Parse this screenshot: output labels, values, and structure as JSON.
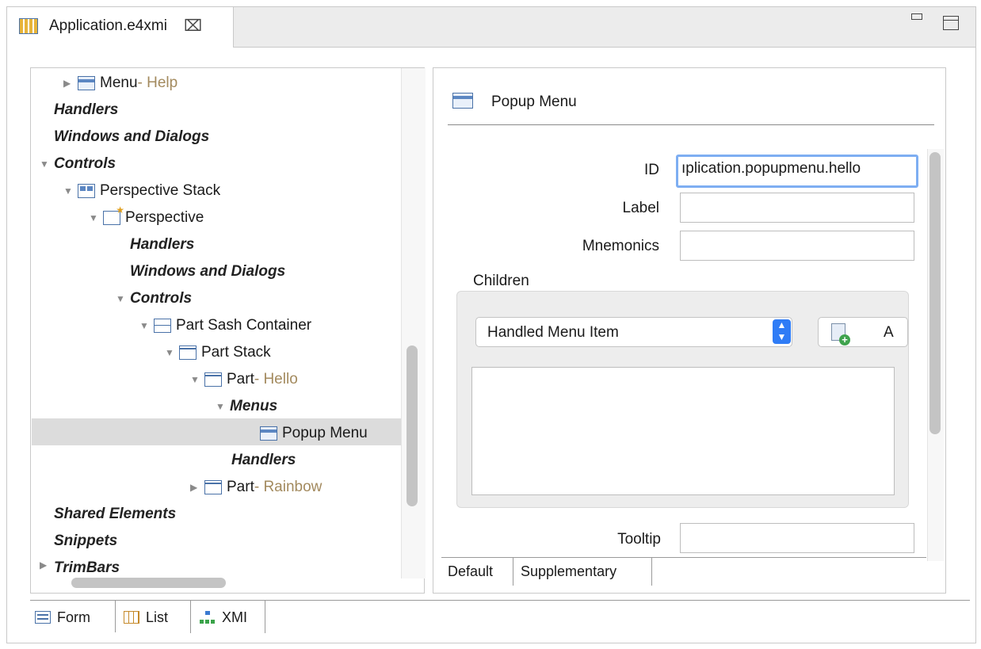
{
  "editor_tab": {
    "title": "Application.e4xmi",
    "close_glyph": "⌧",
    "icon": "model-editor-icon"
  },
  "window_controls": {
    "minimize": "minimize-icon",
    "maximize": "maximize-icon"
  },
  "tree": {
    "nodes": [
      {
        "label": "Menu",
        "suffix": " - Help",
        "twisty": "▶",
        "icon": "menu-icon"
      },
      {
        "label": "Handlers",
        "italic": true
      },
      {
        "label": "Windows and Dialogs",
        "italic": true
      },
      {
        "label": "Controls",
        "italic": true,
        "twisty": "▼"
      },
      {
        "label": "Perspective Stack",
        "twisty": "▼",
        "icon": "perspective-stack-icon"
      },
      {
        "label": "Perspective",
        "twisty": "▼",
        "icon": "perspective-icon"
      },
      {
        "label": "Handlers",
        "italic": true
      },
      {
        "label": "Windows and Dialogs",
        "italic": true
      },
      {
        "label": "Controls",
        "italic": true,
        "twisty": "▼"
      },
      {
        "label": "Part Sash Container",
        "twisty": "▼",
        "icon": "part-sash-container-icon"
      },
      {
        "label": "Part Stack",
        "twisty": "▼",
        "icon": "part-stack-icon"
      },
      {
        "label": "Part",
        "suffix": " - Hello",
        "twisty": "▼",
        "icon": "part-icon"
      },
      {
        "label": "Menus",
        "italic": true,
        "twisty": "▼"
      },
      {
        "label": "Popup Menu",
        "icon": "menu-icon",
        "selected": true
      },
      {
        "label": "Handlers",
        "italic": true
      },
      {
        "label": "Part",
        "suffix": " - Rainbow",
        "twisty": "▶",
        "icon": "part-icon"
      },
      {
        "label": "Shared Elements",
        "italic": true
      },
      {
        "label": "Snippets",
        "italic": true
      },
      {
        "label": "TrimBars",
        "italic": true,
        "twisty": "▶"
      }
    ]
  },
  "details": {
    "title": "Popup Menu",
    "id_label": "ID",
    "id_value": "ıplication.popupmenu.hello",
    "label_label": "Label",
    "label_value": "",
    "mnemonics_label": "Mnemonics",
    "mnemonics_value": "",
    "children_label": "Children",
    "children_combo_value": "Handled Menu Item",
    "add_button_label": "A",
    "tooltip_label": "Tooltip",
    "tooltip_value": "",
    "tabs": [
      "Default",
      "Supplementary"
    ]
  },
  "bottom_tabs": [
    {
      "label": "Form",
      "icon": "form-icon"
    },
    {
      "label": "List",
      "icon": "list-icon"
    },
    {
      "label": "XMI",
      "icon": "xmi-icon"
    }
  ]
}
